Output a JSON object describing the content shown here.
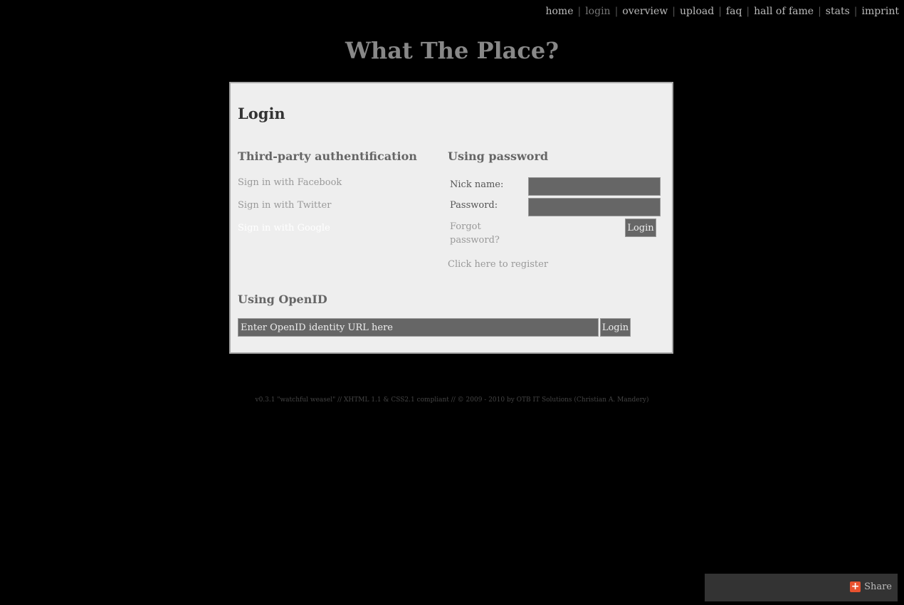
{
  "nav": {
    "items": [
      {
        "label": "home"
      },
      {
        "label": "login"
      },
      {
        "label": "overview"
      },
      {
        "label": "upload"
      },
      {
        "label": "faq"
      },
      {
        "label": "hall of fame"
      },
      {
        "label": "stats"
      },
      {
        "label": "imprint"
      }
    ],
    "separator": "|",
    "current": "login"
  },
  "site_title": "What The Place?",
  "login": {
    "heading": "Login",
    "third_party": {
      "heading": "Third-party authentification",
      "facebook": "Sign in with Facebook",
      "twitter": "Sign in with Twitter",
      "google": "Sign in with Google"
    },
    "password": {
      "heading": "Using password",
      "nick_label": "Nick name:",
      "password_label": "Password:",
      "login_button": "Login",
      "forgot": "Forgot password?",
      "register": "Click here to register"
    },
    "openid": {
      "heading": "Using OpenID",
      "placeholder": "Enter OpenID identity URL here",
      "login_button": "Login"
    }
  },
  "footer": "v0.3.1 \"watchful weasel\" // XHTML 1.1 & CSS2.1 compliant // © 2009 - 2010 by OTB IT Solutions (Christian A. Mandery)",
  "share": {
    "label": "Share",
    "icon": "plus-icon",
    "icon_color": "#e8522f"
  }
}
